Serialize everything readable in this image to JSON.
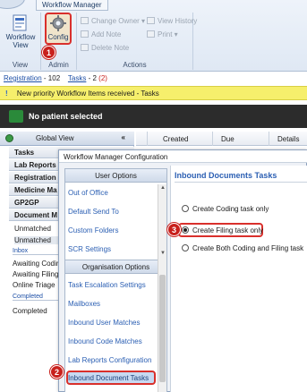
{
  "ribbon": {
    "tab": "Workflow Manager",
    "buttons": {
      "workflow_view": "Workflow View",
      "config": "Config",
      "change_owner": "Change Owner",
      "add_note": "Add Note",
      "delete_note": "Delete Note",
      "view_history": "View History",
      "print": "Print"
    },
    "groups": {
      "view": "View",
      "admin": "Admin",
      "actions": "Actions"
    }
  },
  "callouts": {
    "one": "1",
    "two": "2",
    "three": "3"
  },
  "tabsbar": {
    "registration": "Registration",
    "registration_count": "- 102",
    "tasks": "Tasks",
    "tasks_count": "- 2",
    "tasks_extra": "(2)"
  },
  "notice": {
    "text": "New priority Workflow Items received - Tasks"
  },
  "patientbar": {
    "text": "No patient selected"
  },
  "leftnav": {
    "global_view": "Global View",
    "collapse": "«",
    "items": [
      "Tasks",
      "Lab Reports",
      "Registration",
      "Medicine Ma",
      "GP2GP",
      "Document M"
    ],
    "sub_unmatched": [
      "Unmatched",
      "Unmatched"
    ],
    "inbox_label": "Inbox",
    "inbox_items": [
      "Awaiting Codin",
      "Awaiting Filing",
      "Online Triage"
    ],
    "completed_label": "Completed",
    "completed_items": [
      "Completed"
    ]
  },
  "grid": {
    "columns": [
      "Created",
      "Due",
      "Details"
    ]
  },
  "dialog": {
    "title": "Workflow Manager Configuration",
    "user_options_head": "User Options",
    "user_options": [
      "Out of Office",
      "Default Send To",
      "Custom Folders",
      "SCR Settings"
    ],
    "org_options_head": "Organisation Options",
    "org_options": [
      "Task Escalation Settings",
      "Mailboxes",
      "Inbound User Matches",
      "Inbound Code Matches",
      "Lab Reports Configuration",
      "Inbound Document Tasks"
    ],
    "panel_title": "Inbound Documents Tasks",
    "radios": [
      {
        "label": "Create Coding task only",
        "selected": false
      },
      {
        "label": "Create Filing task only",
        "selected": true
      },
      {
        "label": "Create Both Coding and Filing task",
        "selected": false
      }
    ]
  },
  "colors": {
    "accent": "#2b5fb3",
    "callout": "#c8201c",
    "notice": "#f6ef6c",
    "patientbar": "#2c2c2c"
  }
}
